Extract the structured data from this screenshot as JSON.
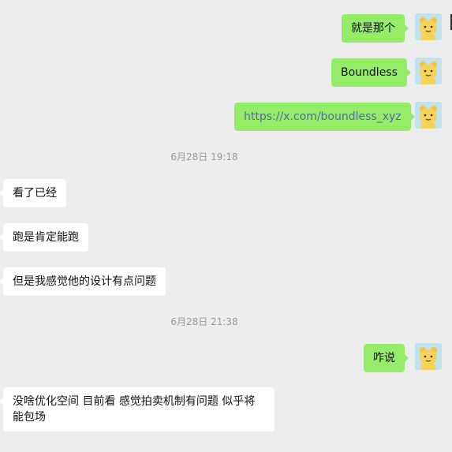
{
  "messages": {
    "m1": "就是那个",
    "m2": "Boundless",
    "m3": "https://x.com/boundless_xyz",
    "t1": "6月28日 19:18",
    "m4": "看了已经",
    "m5": "跑是肯定能跑",
    "m6": "但是我感觉他的设计有点问题",
    "t2": "6月28日 21:38",
    "m7": "咋说",
    "m8": "没啥优化空间 目前看 感觉拍卖机制有问题 似乎将能包场"
  },
  "colors": {
    "outgoing_bubble": "#95ec69",
    "incoming_bubble": "#ffffff",
    "background": "#ededed",
    "link": "#576b95"
  },
  "avatar_icon": "yellow-bear-avatar-icon"
}
